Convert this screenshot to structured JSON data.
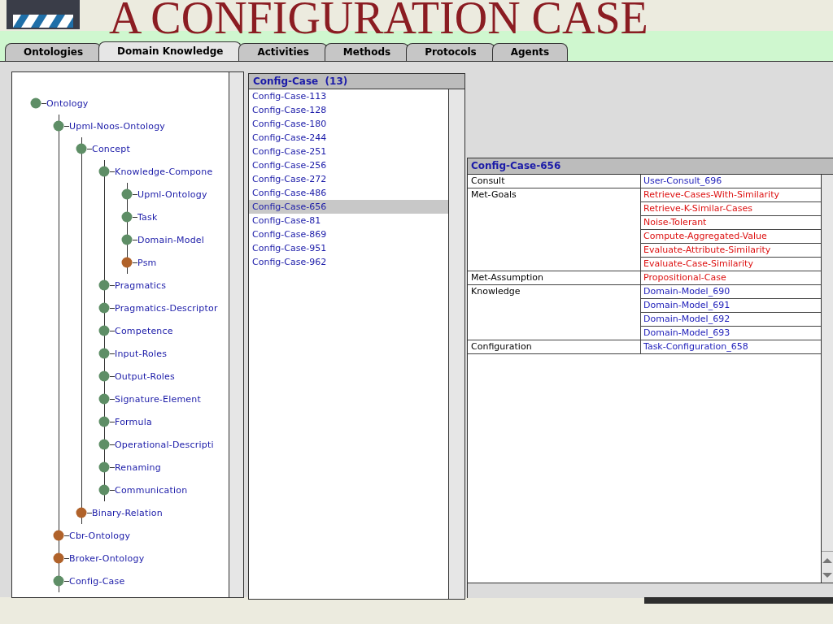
{
  "slide": {
    "title": "A CONFIGURATION CASE"
  },
  "tabs": [
    {
      "label": "Ontologies",
      "selected": false
    },
    {
      "label": "Domain Knowledge",
      "selected": true
    },
    {
      "label": "Activities",
      "selected": false
    },
    {
      "label": "Methods",
      "selected": false
    },
    {
      "label": "Protocols",
      "selected": false
    },
    {
      "label": "Agents",
      "selected": false
    }
  ],
  "tree": {
    "items": [
      {
        "label": "Ontology",
        "color": "#5e8e66",
        "children": [
          {
            "label": "Upml-Noos-Ontology",
            "color": "#5e8e66",
            "children": [
              {
                "label": "Concept",
                "color": "#5e8e66",
                "children": [
                  {
                    "label": "Knowledge-Compone",
                    "color": "#5e8e66",
                    "children": [
                      {
                        "label": "Upml-Ontology",
                        "color": "#5e8e66"
                      },
                      {
                        "label": "Task",
                        "color": "#5e8e66"
                      },
                      {
                        "label": "Domain-Model",
                        "color": "#5e8e66"
                      },
                      {
                        "label": "Psm",
                        "color": "#b0622a"
                      }
                    ]
                  },
                  {
                    "label": "Pragmatics",
                    "color": "#5e8e66"
                  },
                  {
                    "label": "Pragmatics-Descriptor",
                    "color": "#5e8e66"
                  },
                  {
                    "label": "Competence",
                    "color": "#5e8e66"
                  },
                  {
                    "label": "Input-Roles",
                    "color": "#5e8e66"
                  },
                  {
                    "label": "Output-Roles",
                    "color": "#5e8e66"
                  },
                  {
                    "label": "Signature-Element",
                    "color": "#5e8e66"
                  },
                  {
                    "label": "Formula",
                    "color": "#5e8e66"
                  },
                  {
                    "label": "Operational-Descripti",
                    "color": "#5e8e66"
                  },
                  {
                    "label": "Renaming",
                    "color": "#5e8e66"
                  },
                  {
                    "label": "Communication",
                    "color": "#5e8e66"
                  }
                ]
              },
              {
                "label": "Binary-Relation",
                "color": "#b0622a"
              }
            ]
          },
          {
            "label": "Cbr-Ontology",
            "color": "#b0622a"
          },
          {
            "label": "Broker-Ontology",
            "color": "#b0622a"
          },
          {
            "label": "Config-Case",
            "color": "#5e8e66"
          }
        ]
      }
    ]
  },
  "case_list": {
    "title": "Config-Case  (13)",
    "items": [
      {
        "label": "Config-Case-113",
        "selected": false
      },
      {
        "label": "Config-Case-128",
        "selected": false
      },
      {
        "label": "Config-Case-180",
        "selected": false
      },
      {
        "label": "Config-Case-244",
        "selected": false
      },
      {
        "label": "Config-Case-251",
        "selected": false
      },
      {
        "label": "Config-Case-256",
        "selected": false
      },
      {
        "label": "Config-Case-272",
        "selected": false
      },
      {
        "label": "Config-Case-486",
        "selected": false
      },
      {
        "label": "Config-Case-656",
        "selected": true
      },
      {
        "label": "Config-Case-81",
        "selected": false
      },
      {
        "label": "Config-Case-869",
        "selected": false
      },
      {
        "label": "Config-Case-951",
        "selected": false
      },
      {
        "label": "Config-Case-962",
        "selected": false
      }
    ]
  },
  "detail": {
    "title": "Config-Case-656",
    "rows": [
      {
        "property": "Consult",
        "values": [
          {
            "text": "User-Consult_696",
            "color": "#2222bb"
          }
        ]
      },
      {
        "property": "Met-Goals",
        "values": [
          {
            "text": "Retrieve-Cases-With-Similarity",
            "color": "#dd1111"
          },
          {
            "text": "Retrieve-K-Similar-Cases",
            "color": "#dd1111"
          },
          {
            "text": "Noise-Tolerant",
            "color": "#dd1111"
          },
          {
            "text": "Compute-Aggregated-Value",
            "color": "#dd1111"
          },
          {
            "text": "Evaluate-Attribute-Similarity",
            "color": "#dd1111"
          },
          {
            "text": "Evaluate-Case-Similarity",
            "color": "#dd1111"
          }
        ]
      },
      {
        "property": "Met-Assumption",
        "values": [
          {
            "text": "Propositional-Case",
            "color": "#dd1111"
          }
        ]
      },
      {
        "property": "Knowledge",
        "values": [
          {
            "text": "Domain-Model_690",
            "color": "#2222bb"
          },
          {
            "text": "Domain-Model_691",
            "color": "#2222bb"
          },
          {
            "text": "Domain-Model_692",
            "color": "#2222bb"
          },
          {
            "text": "Domain-Model_693",
            "color": "#2222bb"
          }
        ]
      },
      {
        "property": "Configuration",
        "values": [
          {
            "text": "Task-Configuration_658",
            "color": "#2222bb"
          }
        ]
      }
    ]
  }
}
